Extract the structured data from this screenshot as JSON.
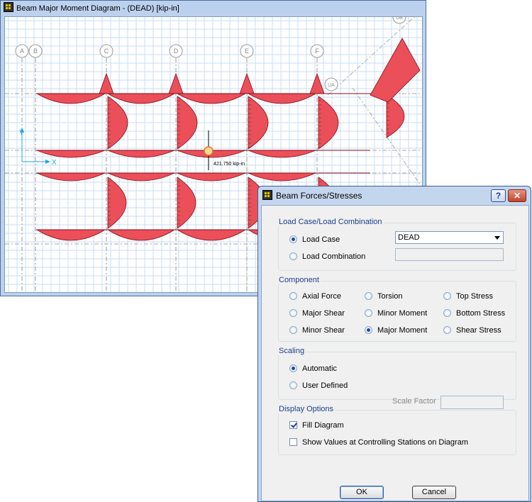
{
  "main_window": {
    "title": "Beam Major Moment Diagram   - (DEAD)  [kip-in]",
    "grid_labels": [
      "A",
      "B",
      "C",
      "D",
      "E",
      "F",
      "UA",
      "UB"
    ],
    "value_readout": "421.750 kip-in",
    "axis_labels": {
      "x": "X",
      "y": "Y"
    },
    "colors": {
      "diagram_fill": "#ea4f5a",
      "diagram_stroke": "#8b0e16",
      "grid_line": "#c9dcf3",
      "axis": "#1ea6e8"
    }
  },
  "dialog": {
    "title": "Beam Forces/Stresses",
    "help_label": "?",
    "close_label": "✕",
    "load_group": {
      "label": "Load Case/Load Combination",
      "load_case_label": "Load Case",
      "load_combination_label": "Load Combination",
      "selected": "Load Case",
      "load_case_value": "DEAD",
      "load_combination_value": ""
    },
    "component_group": {
      "label": "Component",
      "options": [
        "Axial Force",
        "Torsion",
        "Top Stress",
        "Major Shear",
        "Minor Moment",
        "Bottom Stress",
        "Minor Shear",
        "Major Moment",
        "Shear Stress"
      ],
      "selected": "Major Moment"
    },
    "scaling_group": {
      "label": "Scaling",
      "automatic_label": "Automatic",
      "user_defined_label": "User Defined",
      "scale_factor_label": "Scale Factor",
      "scale_factor_value": "",
      "selected": "Automatic"
    },
    "display_group": {
      "label": "Display Options",
      "fill_diagram_label": "Fill Diagram",
      "fill_diagram_checked": true,
      "show_values_label": "Show Values at Controlling Stations on Diagram",
      "show_values_checked": false
    },
    "ok_label": "OK",
    "cancel_label": "Cancel"
  }
}
